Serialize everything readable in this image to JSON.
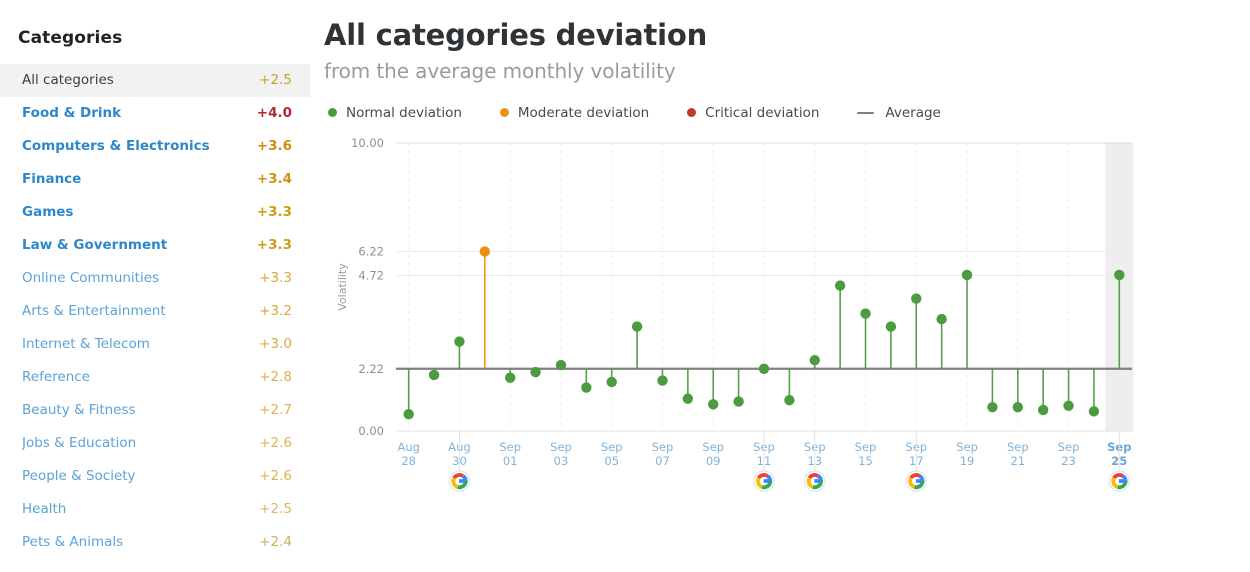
{
  "sidebar": {
    "title": "Categories",
    "items": [
      {
        "label": "All categories",
        "value": "+2.5",
        "color": "#c9a227",
        "name_color": "#3a3f43",
        "bold": false,
        "active": true
      },
      {
        "label": "Food & Drink",
        "value": "+4.0",
        "color": "#b3292e",
        "name_color": "#2f86c8",
        "bold": true,
        "active": false
      },
      {
        "label": "Computers & Electronics",
        "value": "+3.6",
        "color": "#cf8b13",
        "name_color": "#2f86c8",
        "bold": true,
        "active": false
      },
      {
        "label": "Finance",
        "value": "+3.4",
        "color": "#cf9413",
        "name_color": "#2f86c8",
        "bold": true,
        "active": false
      },
      {
        "label": "Games",
        "value": "+3.3",
        "color": "#cf9c13",
        "name_color": "#2f86c8",
        "bold": true,
        "active": false
      },
      {
        "label": "Law & Government",
        "value": "+3.3",
        "color": "#cf9c13",
        "name_color": "#2f86c8",
        "bold": true,
        "active": false
      },
      {
        "label": "Online Communities",
        "value": "+3.3",
        "color": "#d9a43a",
        "name_color": "#5ba3d6",
        "bold": false,
        "active": false
      },
      {
        "label": "Arts & Entertainment",
        "value": "+3.2",
        "color": "#dba63c",
        "name_color": "#5ba3d6",
        "bold": false,
        "active": false
      },
      {
        "label": "Internet & Telecom",
        "value": "+3.0",
        "color": "#dda945",
        "name_color": "#5ba3d6",
        "bold": false,
        "active": false
      },
      {
        "label": "Reference",
        "value": "+2.8",
        "color": "#dfae4c",
        "name_color": "#5ba3d6",
        "bold": false,
        "active": false
      },
      {
        "label": "Beauty & Fitness",
        "value": "+2.7",
        "color": "#e0b053",
        "name_color": "#5ba3d6",
        "bold": false,
        "active": false
      },
      {
        "label": "Jobs & Education",
        "value": "+2.6",
        "color": "#e0b255",
        "name_color": "#5ba3d6",
        "bold": false,
        "active": false
      },
      {
        "label": "People & Society",
        "value": "+2.6",
        "color": "#e0b255",
        "name_color": "#5ba3d6",
        "bold": false,
        "active": false
      },
      {
        "label": "Health",
        "value": "+2.5",
        "color": "#dfb45c",
        "name_color": "#5ba3d6",
        "bold": false,
        "active": false
      },
      {
        "label": "Pets & Animals",
        "value": "+2.4",
        "color": "#c9b25f",
        "name_color": "#5ba3d6",
        "bold": false,
        "active": false
      }
    ]
  },
  "chart_data": {
    "type": "bar",
    "title": "All categories deviation",
    "subtitle": "from the average monthly volatility",
    "xlabel": "",
    "ylabel": "Volatility",
    "ylim": [
      0.0,
      10.0
    ],
    "ytick_values": [
      10.0,
      6.22,
      4.72,
      2.22,
      0.0
    ],
    "ytick_labels": [
      "10.00",
      "6.22",
      "4.72",
      "2.22",
      "0.00"
    ],
    "grid": true,
    "legend_position": "top-left",
    "average_line": 2.22,
    "average_line_label": "Average",
    "legend": [
      {
        "label": "Normal deviation",
        "color": "#4b9b3f",
        "marker": "dot"
      },
      {
        "label": "Moderate deviation",
        "color": "#e8930e",
        "marker": "dot"
      },
      {
        "label": "Critical deviation",
        "color": "#c0392b",
        "marker": "dot"
      },
      {
        "label": "Average",
        "color": "#808080",
        "marker": "line"
      }
    ],
    "highlighted_x": "Sep 25",
    "google_update_markers": [
      "Aug 30",
      "Sep 11",
      "Sep 13",
      "Sep 17",
      "Sep 25"
    ],
    "x": [
      "Aug 28",
      "Aug 29",
      "Aug 30",
      "Aug 31",
      "Sep 01",
      "Sep 02",
      "Sep 03",
      "Sep 04",
      "Sep 05",
      "Sep 06",
      "Sep 07",
      "Sep 08",
      "Sep 09",
      "Sep 10",
      "Sep 11",
      "Sep 12",
      "Sep 13",
      "Sep 14",
      "Sep 15",
      "Sep 16",
      "Sep 17",
      "Sep 18",
      "Sep 19",
      "Sep 20",
      "Sep 21",
      "Sep 22",
      "Sep 23",
      "Sep 24",
      "Sep 25"
    ],
    "xtick_labels": [
      {
        "top": "Aug",
        "bottom": "28"
      },
      {
        "top": "Aug",
        "bottom": "30"
      },
      {
        "top": "Sep",
        "bottom": "01"
      },
      {
        "top": "Sep",
        "bottom": "03"
      },
      {
        "top": "Sep",
        "bottom": "05"
      },
      {
        "top": "Sep",
        "bottom": "07"
      },
      {
        "top": "Sep",
        "bottom": "09"
      },
      {
        "top": "Sep",
        "bottom": "11"
      },
      {
        "top": "Sep",
        "bottom": "13"
      },
      {
        "top": "Sep",
        "bottom": "15"
      },
      {
        "top": "Sep",
        "bottom": "17"
      },
      {
        "top": "Sep",
        "bottom": "19"
      },
      {
        "top": "Sep",
        "bottom": "21"
      },
      {
        "top": "Sep",
        "bottom": "23"
      },
      {
        "top": "Sep",
        "bottom": "25"
      }
    ],
    "series": [
      {
        "name": "Volatility",
        "values": [
          0.6,
          2.0,
          2.95,
          6.22,
          1.9,
          2.1,
          2.32,
          1.55,
          1.75,
          3.35,
          1.8,
          1.15,
          0.95,
          1.05,
          2.22,
          1.1,
          2.45,
          4.45,
          3.7,
          3.35,
          4.1,
          3.55,
          4.75,
          0.85,
          0.85,
          0.75,
          0.9,
          0.7,
          4.75
        ],
        "point_colors": [
          "normal",
          "normal",
          "normal",
          "moderate",
          "normal",
          "normal",
          "normal",
          "normal",
          "normal",
          "normal",
          "normal",
          "normal",
          "normal",
          "normal",
          "normal",
          "normal",
          "normal",
          "normal",
          "normal",
          "normal",
          "normal",
          "normal",
          "normal",
          "normal",
          "normal",
          "normal",
          "normal",
          "normal",
          "normal"
        ]
      }
    ]
  },
  "colors": {
    "normal": "#4b9b3f",
    "moderate": "#e8930e",
    "critical": "#c0392b",
    "average_line": "#808080",
    "highlight_band": "#eeeeee"
  }
}
